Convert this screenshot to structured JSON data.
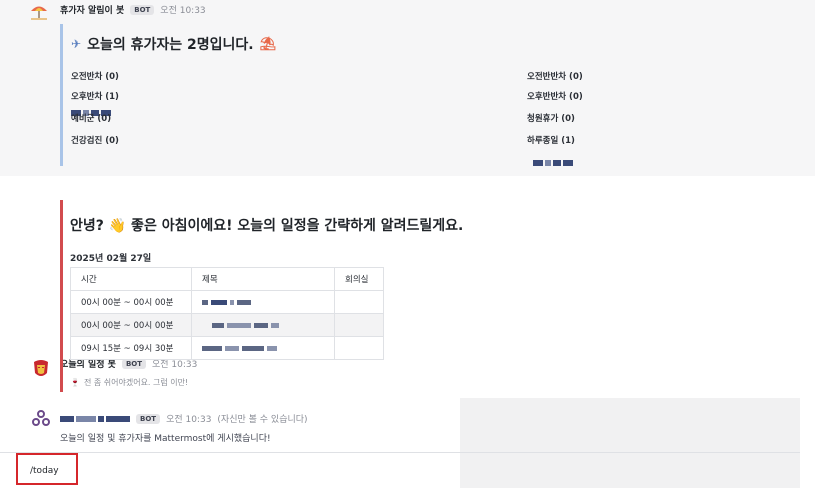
{
  "posts": [
    {
      "author": "휴가자 알림이 봇",
      "badge": "BOT",
      "time": "오전 10:33",
      "avatar_icon": "beach-umbrella-icon",
      "title": "오늘의 휴가자는 2명입니다.",
      "fields_left": [
        {
          "label": "오전반차 (0)"
        },
        {
          "label": "오후반차 (1)"
        },
        {
          "label": "예비군 (0)"
        },
        {
          "label": "건강검진 (0)"
        }
      ],
      "fields_right": [
        {
          "label": "오전반반차 (0)"
        },
        {
          "label": "오후반반차 (0)"
        },
        {
          "label": "청원휴가 (0)"
        },
        {
          "label": "하루종일 (1)"
        }
      ]
    },
    {
      "author": "오늘의 일정 봇",
      "badge": "BOT",
      "time": "오전 10:33",
      "avatar_icon": "iron-mask-icon",
      "title": "안녕? 👋 좋은 아침이에요! 오늘의 일정을 간략하게 알려드릴게요.",
      "date": "2025년 02월 27일",
      "table": {
        "headers": [
          "시간",
          "제목",
          "회의실"
        ],
        "rows": [
          {
            "time": "00시 00분 ~ 00시 00분",
            "title": "",
            "room": ""
          },
          {
            "time": "00시 00분 ~ 00시 00분",
            "title": "",
            "room": ""
          },
          {
            "time": "09시 15분 ~ 09시 30분",
            "title": "",
            "room": ""
          }
        ]
      },
      "footer": "전 좀 쉬어야겠어요. 그럼 이만!"
    },
    {
      "badge": "BOT",
      "time": "오전 10:33",
      "time_note": "(자신만 볼 수 있습니다)",
      "avatar_icon": "webhook-icon",
      "message": "오늘의 일정 및 휴가자를 Mattermost에 게시했습니다!"
    }
  ],
  "input": {
    "value": "/today"
  },
  "colors": {
    "attachment_blue": "#a9c4e8",
    "attachment_red": "#d24b4e",
    "highlight_red": "#d5262b"
  }
}
